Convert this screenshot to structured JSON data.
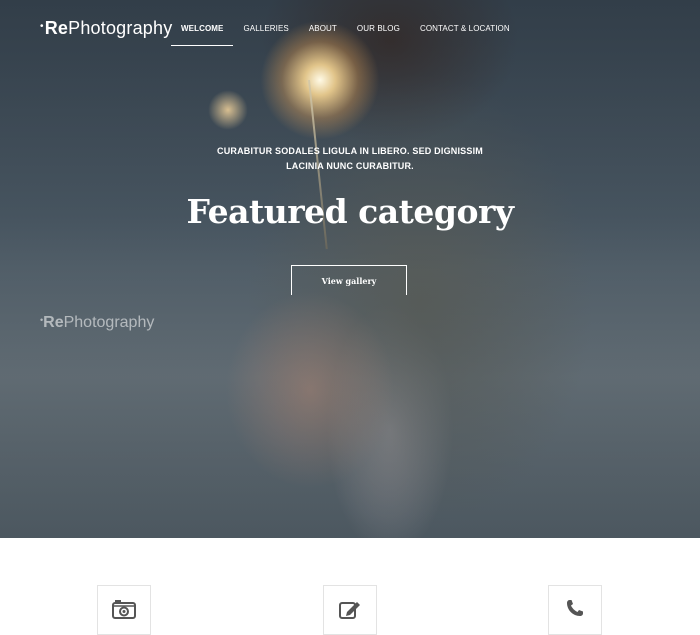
{
  "brand": {
    "logo_mark": "•",
    "logo_bold": "Re",
    "logo_rest": "Photography"
  },
  "nav": {
    "items": [
      {
        "label": "WELCOME",
        "active": true
      },
      {
        "label": "GALLERIES",
        "active": false
      },
      {
        "label": "ABOUT",
        "active": false
      },
      {
        "label": "OUR BLOG",
        "active": false
      },
      {
        "label": "CONTACT & LOCATION",
        "active": false
      }
    ]
  },
  "hero": {
    "tagline_line1": "CURABITUR SODALES LIGULA IN LIBERO. SED DIGNISSIM",
    "tagline_line2": "LACINIA NUNC CURABITUR.",
    "heading": "Featured category",
    "cta_label": "View gallery"
  },
  "watermark": {
    "mark": "•",
    "bold": "Re",
    "rest": "Photography"
  },
  "features": [
    {
      "icon": "camera-icon"
    },
    {
      "icon": "edit-icon"
    },
    {
      "icon": "phone-icon"
    }
  ],
  "colors": {
    "text_on_hero": "#ffffff",
    "feature_border": "#e3e3e3",
    "icon": "#555555"
  }
}
